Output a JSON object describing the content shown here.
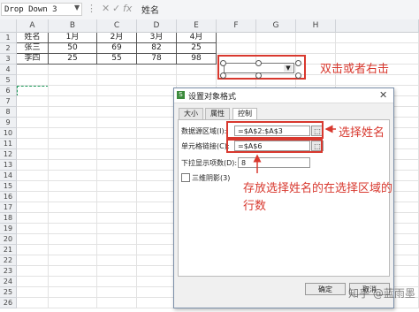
{
  "formula_bar": {
    "name_box": "Drop Down 3",
    "fx_label": "fx",
    "content": "姓名",
    "cancel_icon": "x-icon",
    "confirm_icon": "check-icon"
  },
  "sheet": {
    "columns": [
      "A",
      "B",
      "C",
      "D",
      "E",
      "F",
      "G",
      "H"
    ],
    "rows": [
      "1",
      "2",
      "3",
      "4",
      "5",
      "6",
      "7",
      "8",
      "9",
      "10",
      "11",
      "12",
      "13",
      "14",
      "15",
      "16",
      "17",
      "18",
      "19",
      "20",
      "21",
      "22",
      "23",
      "24",
      "25",
      "26"
    ],
    "table": [
      [
        "姓名",
        "1月",
        "2月",
        "3月",
        "4月"
      ],
      [
        "张三",
        "50",
        "69",
        "82",
        "25"
      ],
      [
        "李四",
        "25",
        "55",
        "78",
        "98"
      ]
    ]
  },
  "dialog": {
    "title": "设置对象格式",
    "tabs": [
      "大小",
      "属性",
      "控制"
    ],
    "active_tab": "控制",
    "source_label": "数据源区域(I):",
    "source_value": "=$A$2:$A$3",
    "link_label": "单元格链接(C):",
    "link_value": "=$A$6",
    "lines_label": "下拉显示项数(D):",
    "lines_value": "8",
    "shadow_label": "三维阴影(3)",
    "ok": "确定",
    "cancel": "取消"
  },
  "annotations": {
    "a1": "双击或者右击",
    "a2": "选择姓名",
    "a3": "存放选择姓名的在选择区域的行数"
  },
  "watermark": "知乎 @蓝雨墨",
  "colors": {
    "annotation": "#d8382e",
    "selection": "#1e9b5b"
  }
}
